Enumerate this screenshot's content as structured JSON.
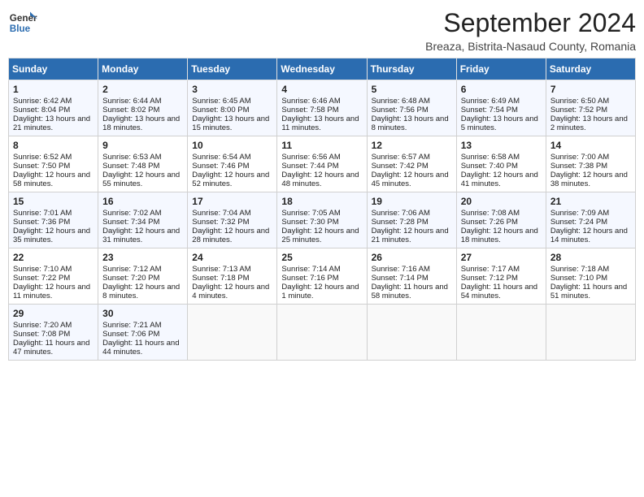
{
  "header": {
    "logo_line1": "General",
    "logo_line2": "Blue",
    "title": "September 2024",
    "subtitle": "Breaza, Bistrita-Nasaud County, Romania"
  },
  "days_of_week": [
    "Sunday",
    "Monday",
    "Tuesday",
    "Wednesday",
    "Thursday",
    "Friday",
    "Saturday"
  ],
  "weeks": [
    [
      {
        "day": 1,
        "sunrise": "6:42 AM",
        "sunset": "8:04 PM",
        "daylight": "13 hours and 21 minutes."
      },
      {
        "day": 2,
        "sunrise": "6:44 AM",
        "sunset": "8:02 PM",
        "daylight": "13 hours and 18 minutes."
      },
      {
        "day": 3,
        "sunrise": "6:45 AM",
        "sunset": "8:00 PM",
        "daylight": "13 hours and 15 minutes."
      },
      {
        "day": 4,
        "sunrise": "6:46 AM",
        "sunset": "7:58 PM",
        "daylight": "13 hours and 11 minutes."
      },
      {
        "day": 5,
        "sunrise": "6:48 AM",
        "sunset": "7:56 PM",
        "daylight": "13 hours and 8 minutes."
      },
      {
        "day": 6,
        "sunrise": "6:49 AM",
        "sunset": "7:54 PM",
        "daylight": "13 hours and 5 minutes."
      },
      {
        "day": 7,
        "sunrise": "6:50 AM",
        "sunset": "7:52 PM",
        "daylight": "13 hours and 2 minutes."
      }
    ],
    [
      {
        "day": 8,
        "sunrise": "6:52 AM",
        "sunset": "7:50 PM",
        "daylight": "12 hours and 58 minutes."
      },
      {
        "day": 9,
        "sunrise": "6:53 AM",
        "sunset": "7:48 PM",
        "daylight": "12 hours and 55 minutes."
      },
      {
        "day": 10,
        "sunrise": "6:54 AM",
        "sunset": "7:46 PM",
        "daylight": "12 hours and 52 minutes."
      },
      {
        "day": 11,
        "sunrise": "6:56 AM",
        "sunset": "7:44 PM",
        "daylight": "12 hours and 48 minutes."
      },
      {
        "day": 12,
        "sunrise": "6:57 AM",
        "sunset": "7:42 PM",
        "daylight": "12 hours and 45 minutes."
      },
      {
        "day": 13,
        "sunrise": "6:58 AM",
        "sunset": "7:40 PM",
        "daylight": "12 hours and 41 minutes."
      },
      {
        "day": 14,
        "sunrise": "7:00 AM",
        "sunset": "7:38 PM",
        "daylight": "12 hours and 38 minutes."
      }
    ],
    [
      {
        "day": 15,
        "sunrise": "7:01 AM",
        "sunset": "7:36 PM",
        "daylight": "12 hours and 35 minutes."
      },
      {
        "day": 16,
        "sunrise": "7:02 AM",
        "sunset": "7:34 PM",
        "daylight": "12 hours and 31 minutes."
      },
      {
        "day": 17,
        "sunrise": "7:04 AM",
        "sunset": "7:32 PM",
        "daylight": "12 hours and 28 minutes."
      },
      {
        "day": 18,
        "sunrise": "7:05 AM",
        "sunset": "7:30 PM",
        "daylight": "12 hours and 25 minutes."
      },
      {
        "day": 19,
        "sunrise": "7:06 AM",
        "sunset": "7:28 PM",
        "daylight": "12 hours and 21 minutes."
      },
      {
        "day": 20,
        "sunrise": "7:08 AM",
        "sunset": "7:26 PM",
        "daylight": "12 hours and 18 minutes."
      },
      {
        "day": 21,
        "sunrise": "7:09 AM",
        "sunset": "7:24 PM",
        "daylight": "12 hours and 14 minutes."
      }
    ],
    [
      {
        "day": 22,
        "sunrise": "7:10 AM",
        "sunset": "7:22 PM",
        "daylight": "12 hours and 11 minutes."
      },
      {
        "day": 23,
        "sunrise": "7:12 AM",
        "sunset": "7:20 PM",
        "daylight": "12 hours and 8 minutes."
      },
      {
        "day": 24,
        "sunrise": "7:13 AM",
        "sunset": "7:18 PM",
        "daylight": "12 hours and 4 minutes."
      },
      {
        "day": 25,
        "sunrise": "7:14 AM",
        "sunset": "7:16 PM",
        "daylight": "12 hours and 1 minute."
      },
      {
        "day": 26,
        "sunrise": "7:16 AM",
        "sunset": "7:14 PM",
        "daylight": "11 hours and 58 minutes."
      },
      {
        "day": 27,
        "sunrise": "7:17 AM",
        "sunset": "7:12 PM",
        "daylight": "11 hours and 54 minutes."
      },
      {
        "day": 28,
        "sunrise": "7:18 AM",
        "sunset": "7:10 PM",
        "daylight": "11 hours and 51 minutes."
      }
    ],
    [
      {
        "day": 29,
        "sunrise": "7:20 AM",
        "sunset": "7:08 PM",
        "daylight": "11 hours and 47 minutes."
      },
      {
        "day": 30,
        "sunrise": "7:21 AM",
        "sunset": "7:06 PM",
        "daylight": "11 hours and 44 minutes."
      },
      null,
      null,
      null,
      null,
      null
    ]
  ]
}
